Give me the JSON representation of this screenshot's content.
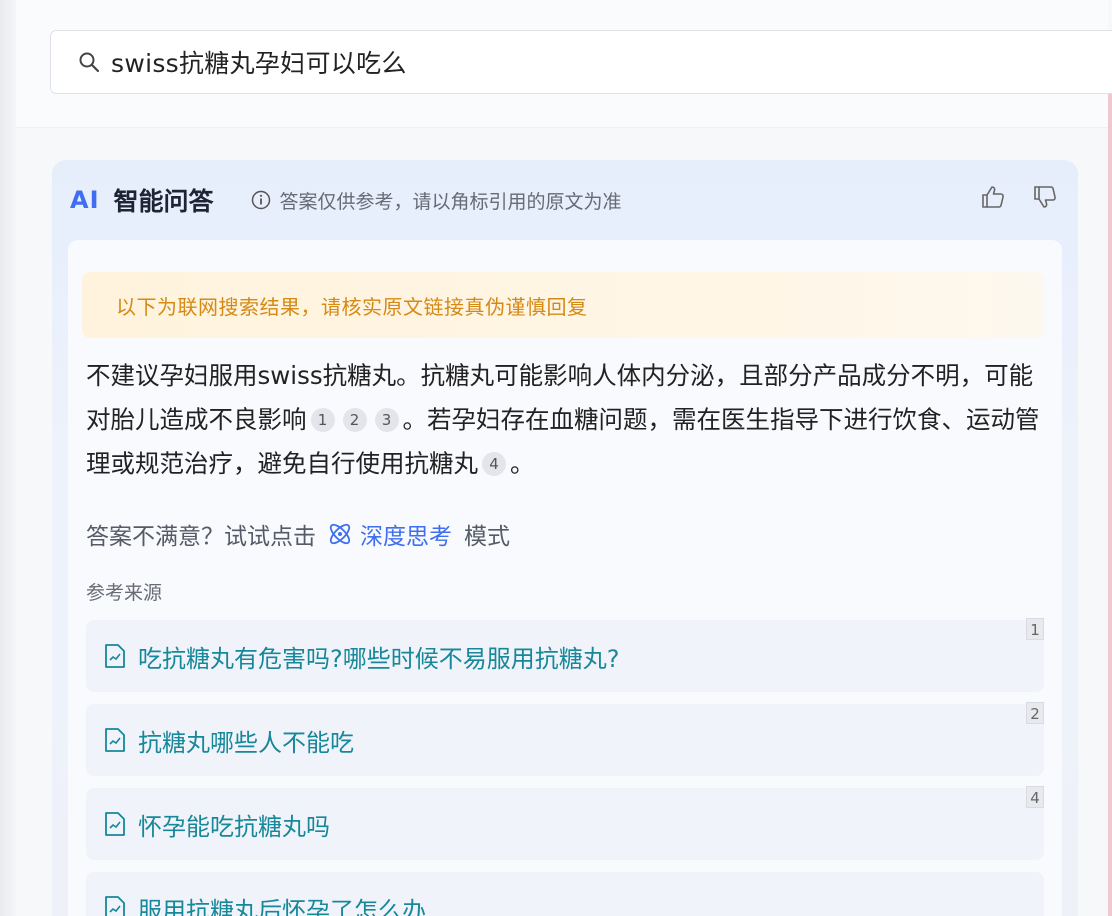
{
  "search": {
    "query": "swiss抗糖丸孕妇可以吃么"
  },
  "ai": {
    "logo": "AI",
    "title": "智能问答",
    "disclaimer": "答案仅供参考，请以角标引用的原文为准"
  },
  "warning": "以下为联网搜索结果，请核实原文链接真伪谨慎回复",
  "answer": {
    "part1": "不建议孕妇服用swiss抗糖丸。抗糖丸可能影响人体内分泌，且部分产品成分不明，可能对胎儿造成不良影响",
    "cite1": "1",
    "cite2": "2",
    "cite3": "3",
    "part2": "。若孕妇存在血糖问题，需在医生指导下进行饮食、运动管理或规范治疗，避免自行使用抗糖丸",
    "cite4": "4",
    "part3": "。"
  },
  "deep": {
    "prefix": "答案不满意？试试点击",
    "link": "深度思考",
    "suffix": "模式"
  },
  "refs": {
    "title": "参考来源",
    "items": [
      {
        "text": "吃抗糖丸有危害吗?哪些时候不易服用抗糖丸?",
        "num": "1"
      },
      {
        "text": "抗糖丸哪些人不能吃",
        "num": "2"
      },
      {
        "text": "怀孕能吃抗糖丸吗",
        "num": "4"
      },
      {
        "text": "服用抗糖丸后怀孕了怎么办",
        "num": ""
      }
    ]
  },
  "colors": {
    "accent": "#3f6ef0",
    "warning": "#d58a16",
    "link": "#17889a"
  }
}
